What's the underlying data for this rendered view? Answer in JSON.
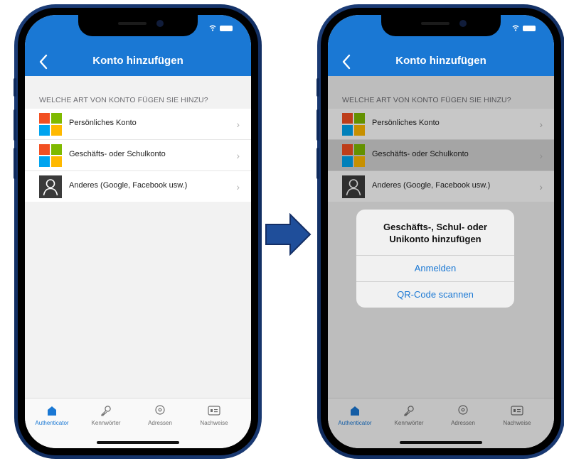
{
  "colors": {
    "accent": "#1a78d4",
    "phone_frame": "#0e2a5c",
    "ms_red": "#f25022",
    "ms_green": "#7fba00",
    "ms_blue": "#00a4ef",
    "ms_yellow": "#ffb900"
  },
  "screen": {
    "title": "Konto hinzufügen",
    "section_header": "WELCHE ART VON KONTO FÜGEN SIE HINZU?",
    "accounts": [
      {
        "label": "Persönliches Konto",
        "icon": "microsoft-logo-icon"
      },
      {
        "label": "Geschäfts- oder Schulkonto",
        "icon": "microsoft-logo-icon"
      },
      {
        "label": "Anderes (Google, Facebook usw.)",
        "icon": "person-icon"
      }
    ],
    "tabs": [
      {
        "label": "Authenticator",
        "icon": "home-icon"
      },
      {
        "label": "Kennwörter",
        "icon": "key-icon"
      },
      {
        "label": "Adressen",
        "icon": "location-pin-icon"
      },
      {
        "label": "Nachweise",
        "icon": "id-card-icon"
      }
    ]
  },
  "dialog": {
    "title": "Geschäfts-, Schul- oder\nUnikonto hinzufügen",
    "actions": [
      "Anmelden",
      "QR-Code scannen"
    ]
  },
  "transition_icon": "right-arrow-icon"
}
